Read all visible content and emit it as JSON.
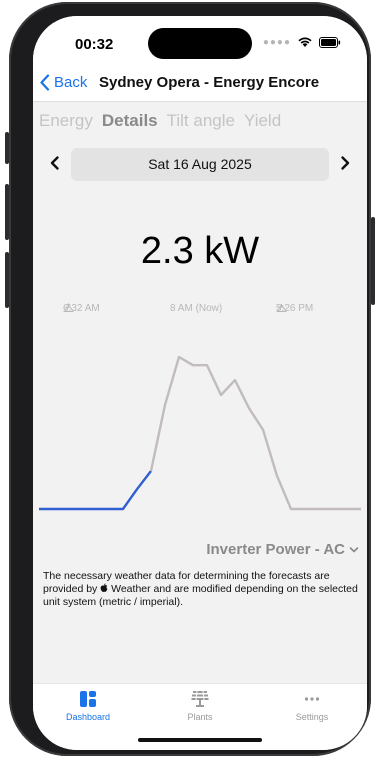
{
  "status": {
    "time": "00:32"
  },
  "nav": {
    "back_label": "Back",
    "title": "Sydney Opera - Energy Encore"
  },
  "tabs": [
    {
      "label": "Energy",
      "active": false
    },
    {
      "label": "Details",
      "active": true
    },
    {
      "label": "Tilt angle",
      "active": false
    },
    {
      "label": "Yield",
      "active": false
    }
  ],
  "date": {
    "label": "Sat 16 Aug 2025"
  },
  "current": {
    "value": "2.3 kW"
  },
  "timeline": {
    "sunrise": "6:32 AM",
    "now": "8 AM (Now)",
    "sunset": "5:26 PM"
  },
  "metric": {
    "label": "Inverter Power - AC"
  },
  "notice": {
    "pre": "The necessary weather data for determining the forecasts are provided by ",
    "post": "Weather and are modified depending on the selected unit system (metric / imperial)."
  },
  "tabbar": [
    {
      "label": "Dashboard",
      "icon": "dashboard-icon",
      "active": true
    },
    {
      "label": "Plants",
      "icon": "solar-panel-icon",
      "active": false
    },
    {
      "label": "Settings",
      "icon": "ellipsis-icon",
      "active": false
    }
  ],
  "colors": {
    "accent": "#1a73e8",
    "past_line": "#2f5fd0",
    "forecast_line": "#c2bcbc"
  },
  "chart_data": {
    "type": "line",
    "title": "",
    "x": [
      0,
      1,
      2,
      3,
      4,
      5,
      6,
      7,
      8,
      9,
      10,
      11,
      12,
      13,
      14,
      15,
      16,
      17,
      18,
      19,
      20,
      21,
      22,
      23
    ],
    "series": [
      {
        "values": [
          0,
          0,
          0,
          0,
          0,
          0,
          0,
          1.2,
          2.3
        ]
      },
      {
        "values": [
          null,
          null,
          null,
          null,
          null,
          null,
          null,
          null,
          2.3,
          6.3,
          9.2,
          8.7,
          8.7,
          6.9,
          7.8,
          6.1,
          4.8,
          2.0,
          0,
          0,
          0,
          0,
          0,
          0
        ]
      }
    ],
    "grid": false,
    "legend": "none"
  }
}
